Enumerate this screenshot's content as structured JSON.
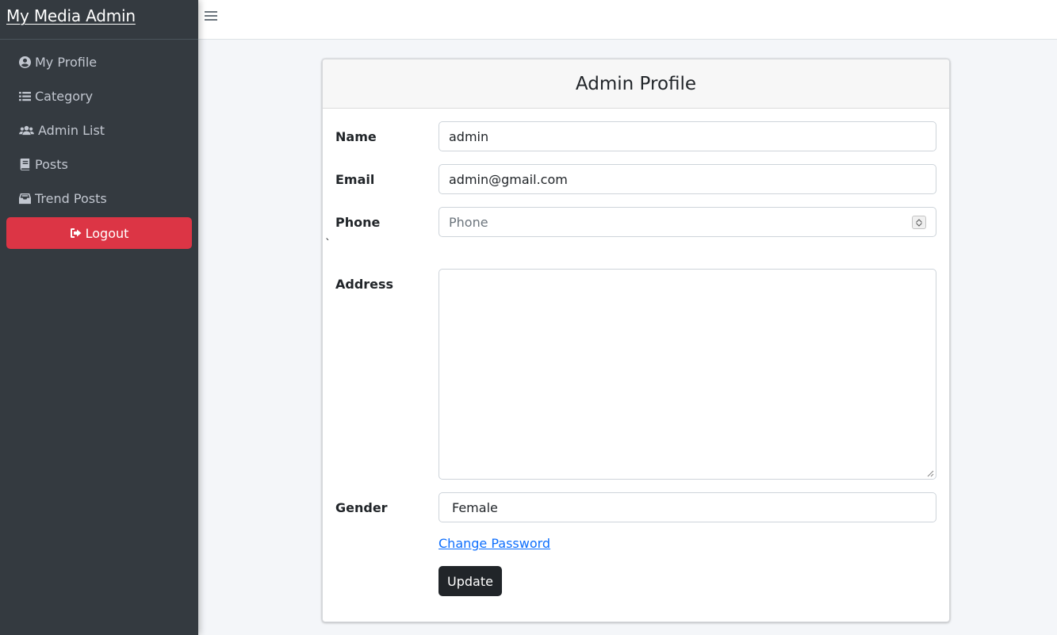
{
  "brand": {
    "title": "My Media Admin"
  },
  "sidebar": {
    "items": [
      {
        "label": "My Profile",
        "icon": "user-circle-icon"
      },
      {
        "label": "Category",
        "icon": "list-icon"
      },
      {
        "label": "Admin List",
        "icon": "users-icon"
      },
      {
        "label": "Posts",
        "icon": "book-icon"
      },
      {
        "label": "Trend Posts",
        "icon": "inbox-icon"
      }
    ],
    "logout": {
      "label": "Logout",
      "icon": "sign-out-icon"
    }
  },
  "topbar": {
    "menu_icon": "hamburger-icon"
  },
  "card": {
    "title": "Admin Profile",
    "name": {
      "label": "Name",
      "value": "admin"
    },
    "email": {
      "label": "Email",
      "value": "admin@gmail.com"
    },
    "phone": {
      "label": "Phone",
      "placeholder": "Phone"
    },
    "stray_char": "`",
    "address": {
      "label": "Address",
      "value": ""
    },
    "gender": {
      "label": "Gender",
      "value": "Female"
    },
    "change_password": "Change Password",
    "update": "Update"
  },
  "colors": {
    "sidebar_bg": "#343a40",
    "logout_bg": "#dc3545",
    "link": "#0d6efd",
    "button_bg": "#212529"
  }
}
